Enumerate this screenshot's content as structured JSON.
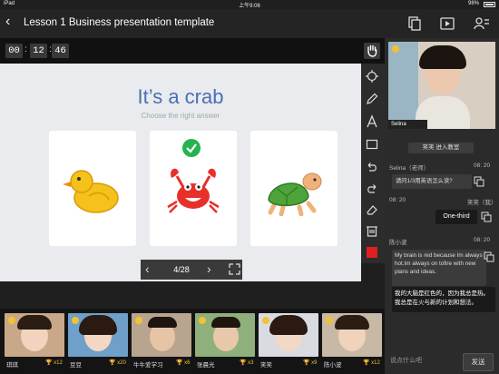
{
  "status_bar": {
    "device": "iPad",
    "time": "上午9:06",
    "battery": "98%"
  },
  "header": {
    "title": "Lesson 1 Business presentation template",
    "icons": [
      "back-chevron-icon",
      "copy-icon",
      "video-player-icon",
      "user-list-icon"
    ]
  },
  "timer": {
    "hours": "00",
    "minutes": "12",
    "seconds": "46"
  },
  "slide": {
    "title": "It’s a crab",
    "subtitle": "Choose the right answer",
    "choices": [
      "duck",
      "crab",
      "turtle"
    ],
    "correct": "crab",
    "page": "4/28"
  },
  "tools": [
    "hand-icon",
    "pointer-icon",
    "pen-icon",
    "text-icon",
    "rectangle-icon",
    "undo-icon",
    "redo-icon",
    "eraser-icon",
    "delete-icon",
    "color-swatch-icon"
  ],
  "colors": {
    "accent_title": "#4a6fb5",
    "check": "#25b350",
    "swatch": "#e02020",
    "score": "#e8c33d"
  },
  "students": [
    {
      "name": "琪琪",
      "score": "x12"
    },
    {
      "name": "豆豆",
      "score": "x20"
    },
    {
      "name": "牛牛爱学习",
      "score": "x6"
    },
    {
      "name": "张晨光",
      "score": "x3"
    },
    {
      "name": "笑笑",
      "score": "x9"
    },
    {
      "name": "陈小波",
      "score": "x12"
    }
  ],
  "teacher": {
    "name": "Selina"
  },
  "chat": {
    "join_notice": "笑笑 进入教室",
    "messages": [
      {
        "sender": "Selina（老师）",
        "time": "08: 20",
        "text": "请问1/3用英语怎么读?"
      },
      {
        "time": "08: 20",
        "sender": "笑笑（我）",
        "text": "One-third"
      },
      {
        "sender": "陈小波",
        "time": "08: 20",
        "text": "My brain is red because Im always hot.Im always on tofire with new plans and ideas.",
        "translation": "我的大脑是红色的，因为我总是热。我总是在火与新的计划和想法。"
      }
    ],
    "placeholder": "说点什么吧",
    "send_label": "发送"
  }
}
